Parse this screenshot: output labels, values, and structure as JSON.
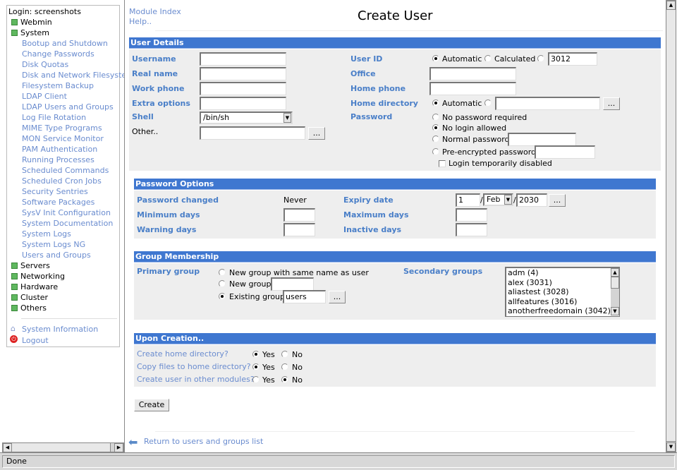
{
  "sidebar": {
    "login": "Login: screenshots",
    "categories_top": [
      "Webmin",
      "System"
    ],
    "system_items": [
      "Bootup and Shutdown",
      "Change Passwords",
      "Disk Quotas",
      "Disk and Network Filesystem",
      "Filesystem Backup",
      "LDAP Client",
      "LDAP Users and Groups",
      "Log File Rotation",
      "MIME Type Programs",
      "MON Service Monitor",
      "PAM Authentication",
      "Running Processes",
      "Scheduled Commands",
      "Scheduled Cron Jobs",
      "Security Sentries",
      "Software Packages",
      "SysV Init Configuration",
      "System Documentation",
      "System Logs",
      "System Logs NG",
      "Users and Groups"
    ],
    "categories_bottom": [
      "Servers",
      "Networking",
      "Hardware",
      "Cluster",
      "Others"
    ],
    "system_information": "System Information",
    "logout": "Logout"
  },
  "header": {
    "module_index": "Module Index",
    "help": "Help..",
    "title": "Create User"
  },
  "user_details": {
    "heading": "User Details",
    "username": "Username",
    "real_name": "Real name",
    "work_phone": "Work phone",
    "extra_options": "Extra options",
    "shell": "Shell",
    "shell_value": "/bin/sh",
    "other": "Other..",
    "user_id": "User ID",
    "uid_automatic": "Automatic",
    "uid_calculated": "Calculated",
    "uid_value": "3012",
    "office": "Office",
    "home_phone": "Home phone",
    "home_directory": "Home directory",
    "home_automatic": "Automatic",
    "password": "Password",
    "pw_none": "No password required",
    "pw_nologin": "No login allowed",
    "pw_normal": "Normal password",
    "pw_encrypted": "Pre-encrypted password",
    "login_disabled": "Login temporarily disabled",
    "browse": "..."
  },
  "password_options": {
    "heading": "Password Options",
    "changed": "Password changed",
    "changed_value": "Never",
    "expiry": "Expiry date",
    "expiry_day": "1",
    "expiry_month": "Feb",
    "expiry_year": "2030",
    "min_days": "Minimum days",
    "max_days": "Maximum days",
    "warning_days": "Warning days",
    "inactive_days": "Inactive days",
    "sep": "/"
  },
  "group_membership": {
    "heading": "Group Membership",
    "primary": "Primary group",
    "opt_same": "New group with same name as user",
    "opt_new": "New group",
    "opt_existing": "Existing group",
    "existing_value": "users",
    "secondary": "Secondary groups",
    "groups": [
      "adm (4)",
      "alex (3031)",
      "aliastest (3028)",
      "allfeatures (3016)",
      "anotherfreedomain (3042)"
    ]
  },
  "upon_creation": {
    "heading": "Upon Creation..",
    "create_home": "Create home directory?",
    "copy_files": "Copy files to home directory?",
    "other_modules": "Create user in other modules?",
    "yes": "Yes",
    "no": "No"
  },
  "create_button": "Create",
  "return_link": "Return to users and groups list",
  "status": "Done",
  "colors": {
    "section_header": "#3f77d0",
    "label": "#4a7fc8",
    "link": "#6a8ccf"
  }
}
